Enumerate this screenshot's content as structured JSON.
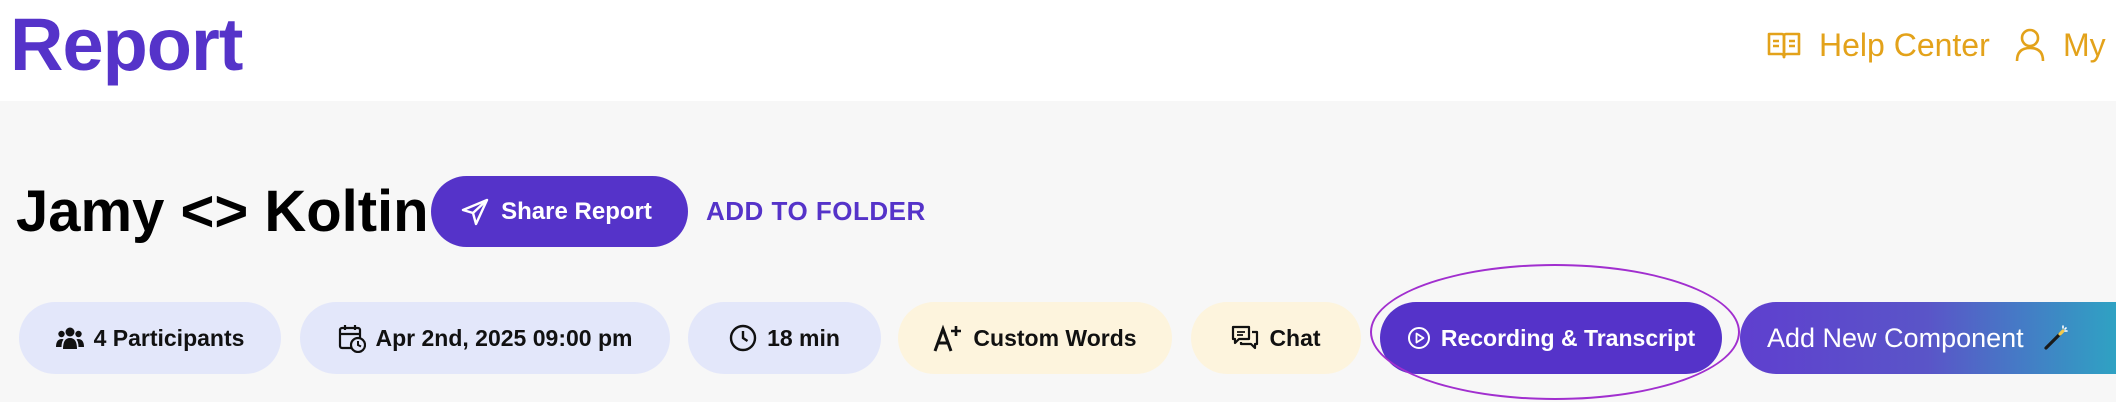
{
  "header": {
    "brand": "Report",
    "help_label": "Help Center",
    "account_label": "My"
  },
  "report": {
    "title": "Jamy <> Koltin",
    "share_label": "Share Report",
    "folder_label": "ADD TO FOLDER"
  },
  "chips": {
    "participants": "4 Participants",
    "date": "Apr 2nd, 2025 09:00 pm",
    "duration": "18 min",
    "custom_words": "Custom Words",
    "chat": "Chat",
    "recording": "Recording & Transcript"
  },
  "add_component_label": "Add New Component",
  "colors": {
    "brand": "#5533c9",
    "accent_gold": "#e3a21a",
    "chip_blue": "#e3e7fa",
    "chip_cream": "#fdf4dd",
    "highlight": "#a12fcf"
  },
  "icons": [
    "book-icon",
    "user-icon",
    "paper-plane-icon",
    "people-icon",
    "calendar-clock-icon",
    "clock-icon",
    "font-plus-icon",
    "chat-icon",
    "play-circle-icon",
    "magic-wand-icon"
  ]
}
